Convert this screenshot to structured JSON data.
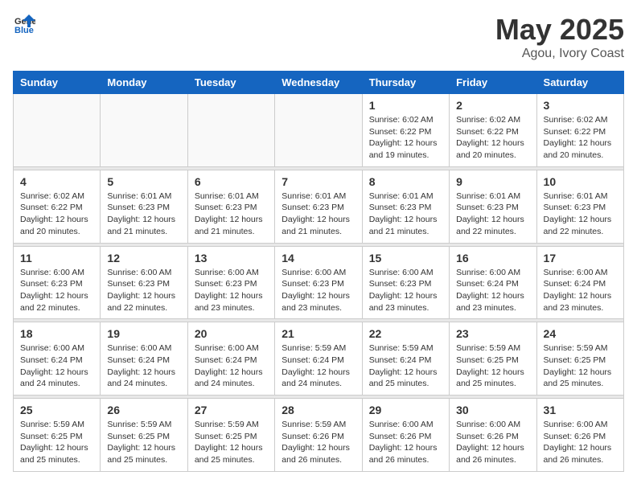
{
  "header": {
    "logo": {
      "general": "General",
      "blue": "Blue"
    },
    "title": "May 2025",
    "location": "Agou, Ivory Coast"
  },
  "calendar": {
    "days_of_week": [
      "Sunday",
      "Monday",
      "Tuesday",
      "Wednesday",
      "Thursday",
      "Friday",
      "Saturday"
    ],
    "weeks": [
      [
        {
          "day": "",
          "info": ""
        },
        {
          "day": "",
          "info": ""
        },
        {
          "day": "",
          "info": ""
        },
        {
          "day": "",
          "info": ""
        },
        {
          "day": "1",
          "info": "Sunrise: 6:02 AM\nSunset: 6:22 PM\nDaylight: 12 hours\nand 19 minutes."
        },
        {
          "day": "2",
          "info": "Sunrise: 6:02 AM\nSunset: 6:22 PM\nDaylight: 12 hours\nand 20 minutes."
        },
        {
          "day": "3",
          "info": "Sunrise: 6:02 AM\nSunset: 6:22 PM\nDaylight: 12 hours\nand 20 minutes."
        }
      ],
      [
        {
          "day": "4",
          "info": "Sunrise: 6:02 AM\nSunset: 6:22 PM\nDaylight: 12 hours\nand 20 minutes."
        },
        {
          "day": "5",
          "info": "Sunrise: 6:01 AM\nSunset: 6:23 PM\nDaylight: 12 hours\nand 21 minutes."
        },
        {
          "day": "6",
          "info": "Sunrise: 6:01 AM\nSunset: 6:23 PM\nDaylight: 12 hours\nand 21 minutes."
        },
        {
          "day": "7",
          "info": "Sunrise: 6:01 AM\nSunset: 6:23 PM\nDaylight: 12 hours\nand 21 minutes."
        },
        {
          "day": "8",
          "info": "Sunrise: 6:01 AM\nSunset: 6:23 PM\nDaylight: 12 hours\nand 21 minutes."
        },
        {
          "day": "9",
          "info": "Sunrise: 6:01 AM\nSunset: 6:23 PM\nDaylight: 12 hours\nand 22 minutes."
        },
        {
          "day": "10",
          "info": "Sunrise: 6:01 AM\nSunset: 6:23 PM\nDaylight: 12 hours\nand 22 minutes."
        }
      ],
      [
        {
          "day": "11",
          "info": "Sunrise: 6:00 AM\nSunset: 6:23 PM\nDaylight: 12 hours\nand 22 minutes."
        },
        {
          "day": "12",
          "info": "Sunrise: 6:00 AM\nSunset: 6:23 PM\nDaylight: 12 hours\nand 22 minutes."
        },
        {
          "day": "13",
          "info": "Sunrise: 6:00 AM\nSunset: 6:23 PM\nDaylight: 12 hours\nand 23 minutes."
        },
        {
          "day": "14",
          "info": "Sunrise: 6:00 AM\nSunset: 6:23 PM\nDaylight: 12 hours\nand 23 minutes."
        },
        {
          "day": "15",
          "info": "Sunrise: 6:00 AM\nSunset: 6:23 PM\nDaylight: 12 hours\nand 23 minutes."
        },
        {
          "day": "16",
          "info": "Sunrise: 6:00 AM\nSunset: 6:24 PM\nDaylight: 12 hours\nand 23 minutes."
        },
        {
          "day": "17",
          "info": "Sunrise: 6:00 AM\nSunset: 6:24 PM\nDaylight: 12 hours\nand 23 minutes."
        }
      ],
      [
        {
          "day": "18",
          "info": "Sunrise: 6:00 AM\nSunset: 6:24 PM\nDaylight: 12 hours\nand 24 minutes."
        },
        {
          "day": "19",
          "info": "Sunrise: 6:00 AM\nSunset: 6:24 PM\nDaylight: 12 hours\nand 24 minutes."
        },
        {
          "day": "20",
          "info": "Sunrise: 6:00 AM\nSunset: 6:24 PM\nDaylight: 12 hours\nand 24 minutes."
        },
        {
          "day": "21",
          "info": "Sunrise: 5:59 AM\nSunset: 6:24 PM\nDaylight: 12 hours\nand 24 minutes."
        },
        {
          "day": "22",
          "info": "Sunrise: 5:59 AM\nSunset: 6:24 PM\nDaylight: 12 hours\nand 25 minutes."
        },
        {
          "day": "23",
          "info": "Sunrise: 5:59 AM\nSunset: 6:25 PM\nDaylight: 12 hours\nand 25 minutes."
        },
        {
          "day": "24",
          "info": "Sunrise: 5:59 AM\nSunset: 6:25 PM\nDaylight: 12 hours\nand 25 minutes."
        }
      ],
      [
        {
          "day": "25",
          "info": "Sunrise: 5:59 AM\nSunset: 6:25 PM\nDaylight: 12 hours\nand 25 minutes."
        },
        {
          "day": "26",
          "info": "Sunrise: 5:59 AM\nSunset: 6:25 PM\nDaylight: 12 hours\nand 25 minutes."
        },
        {
          "day": "27",
          "info": "Sunrise: 5:59 AM\nSunset: 6:25 PM\nDaylight: 12 hours\nand 25 minutes."
        },
        {
          "day": "28",
          "info": "Sunrise: 5:59 AM\nSunset: 6:26 PM\nDaylight: 12 hours\nand 26 minutes."
        },
        {
          "day": "29",
          "info": "Sunrise: 6:00 AM\nSunset: 6:26 PM\nDaylight: 12 hours\nand 26 minutes."
        },
        {
          "day": "30",
          "info": "Sunrise: 6:00 AM\nSunset: 6:26 PM\nDaylight: 12 hours\nand 26 minutes."
        },
        {
          "day": "31",
          "info": "Sunrise: 6:00 AM\nSunset: 6:26 PM\nDaylight: 12 hours\nand 26 minutes."
        }
      ]
    ]
  }
}
